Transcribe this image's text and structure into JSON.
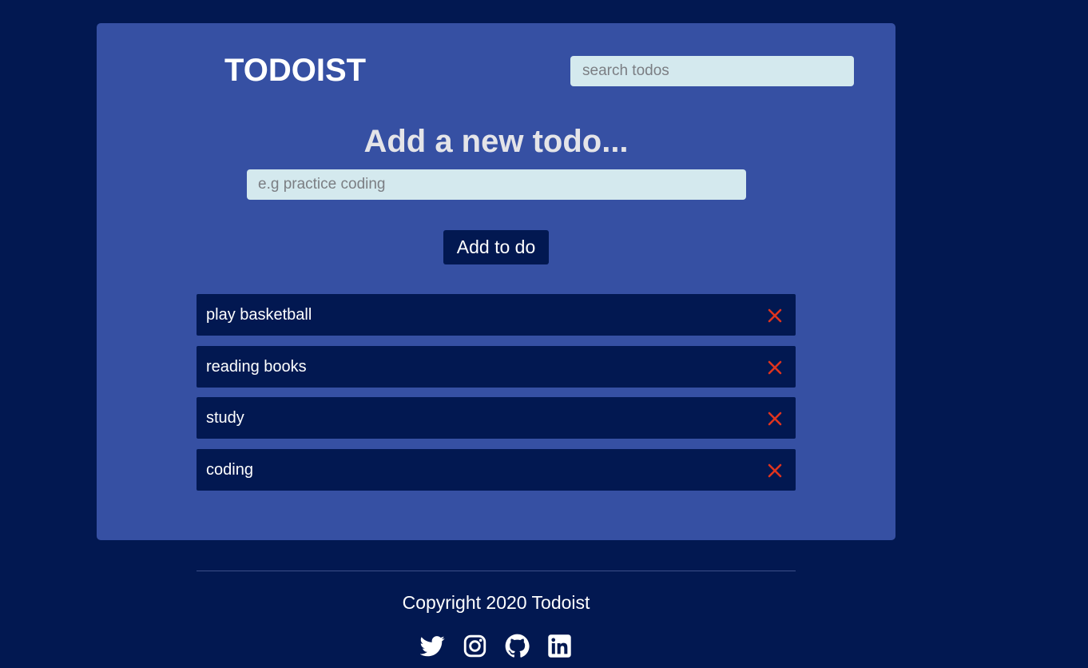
{
  "header": {
    "title": "TODOIST",
    "search_placeholder": "search todos"
  },
  "add_form": {
    "heading": "Add a new todo...",
    "input_placeholder": "e.g practice coding",
    "button_label": "Add to do"
  },
  "todos": [
    {
      "text": "play basketball",
      "delete_icon": "close-icon"
    },
    {
      "text": "reading books",
      "delete_icon": "close-icon"
    },
    {
      "text": "study",
      "delete_icon": "close-icon"
    },
    {
      "text": "coding",
      "delete_icon": "close-icon"
    }
  ],
  "footer": {
    "copyright": "Copyright 2020 Todoist",
    "social_icons": [
      "twitter-icon",
      "instagram-icon",
      "github-icon",
      "linkedin-icon"
    ]
  },
  "colors": {
    "background": "#021851",
    "card": "#3650a3",
    "input": "#d4e9ee",
    "delete": "#e0341e"
  }
}
